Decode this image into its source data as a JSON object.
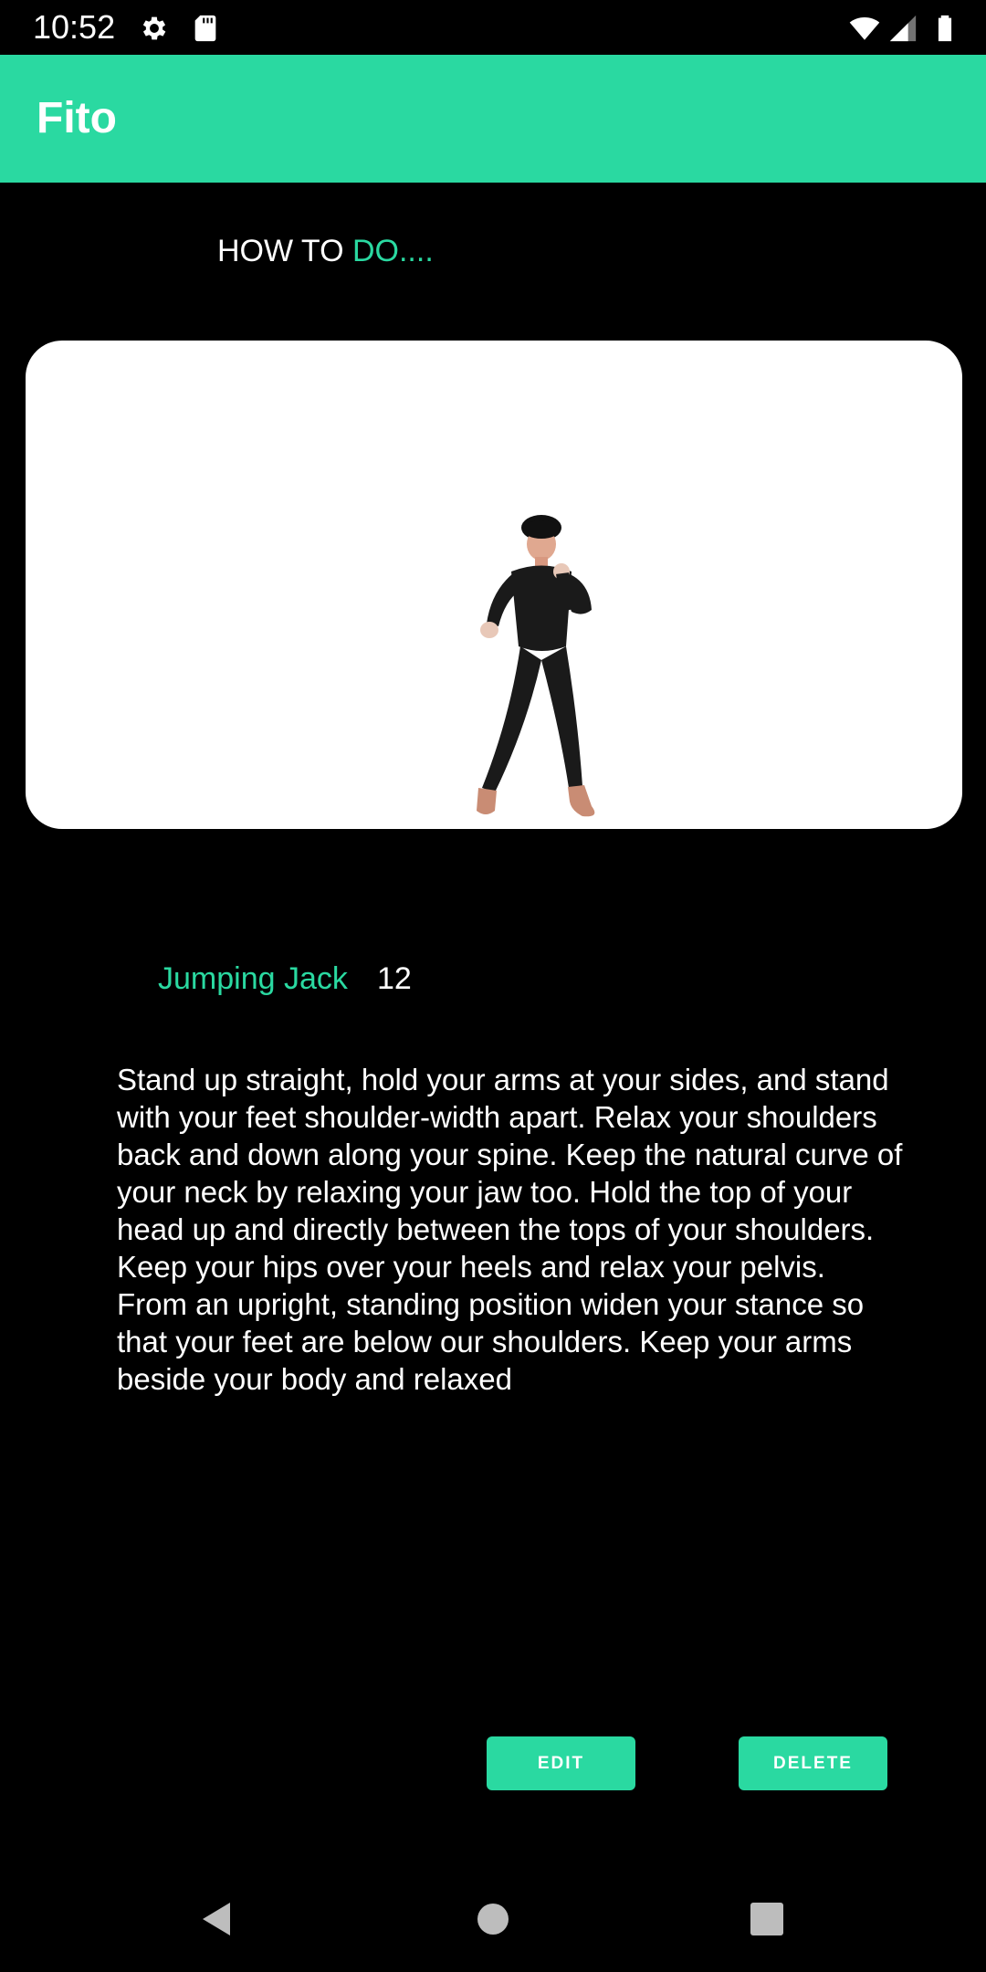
{
  "status_bar": {
    "time": "10:52",
    "icons": [
      "settings-icon",
      "sd-card-icon",
      "wifi-icon",
      "cell-signal-icon",
      "battery-icon"
    ]
  },
  "app_bar": {
    "title": "Fito",
    "color": "#2ad9a1"
  },
  "heading": {
    "part1": "HOW TO ",
    "part2": "DO...."
  },
  "exercise": {
    "image": "exercise-demo-figure",
    "name": "Jumping Jack",
    "count": "12",
    "description_1": "Stand up straight, hold your arms at your sides, and stand with your feet shoulder-width apart. Relax your shoulders back and down along your spine. Keep the natural curve of your neck by relaxing your jaw too. Hold the top of your head up and directly between the tops of your shoulders. Keep your hips over your heels and relax your pelvis.",
    "description_2": "From an upright, standing position widen your stance so that your feet are below our shoulders. Keep your arms beside your body and relaxed"
  },
  "actions": {
    "edit_label": "EDIT",
    "delete_label": "DELETE"
  },
  "nav_bar": {
    "icons": [
      "back-icon",
      "home-icon",
      "recents-icon"
    ]
  },
  "colors": {
    "accent": "#2ad9a1",
    "background": "#000000",
    "card": "#ffffff"
  }
}
